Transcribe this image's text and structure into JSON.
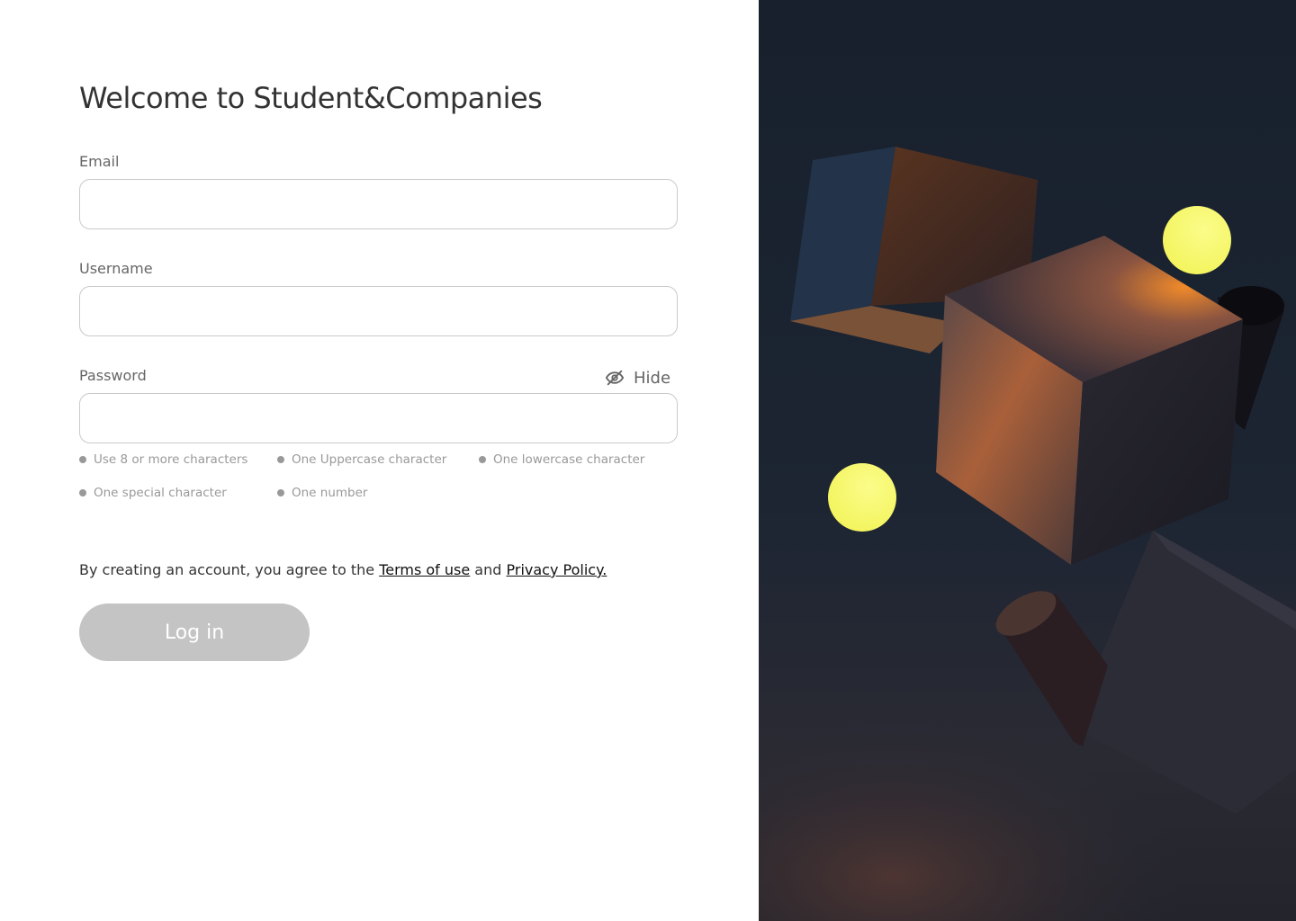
{
  "title": "Welcome to Student&Companies",
  "form": {
    "email": {
      "label": "Email",
      "value": "",
      "placeholder": ""
    },
    "username": {
      "label": "Username",
      "value": "",
      "placeholder": ""
    },
    "password": {
      "label": "Password",
      "value": "",
      "placeholder": "",
      "toggle_label": "Hide",
      "requirements": [
        "Use 8 or more characters",
        "One Uppercase character",
        "One lowercase character",
        "One special character",
        "One number"
      ]
    }
  },
  "agreement": {
    "prefix": "By creating an account, you agree to the ",
    "terms_link": "Terms of use",
    "and": " and ",
    "privacy_link": "Privacy Policy."
  },
  "login_button": {
    "label": "Log in",
    "enabled": false
  },
  "colors": {
    "button_disabled": "#c4c4c4",
    "text_primary": "#333333",
    "text_secondary": "#666666",
    "hint": "#999999",
    "hero_background": "#1a2230",
    "hero_accent_yellow": "#f7f86a",
    "hero_accent_orange": "#d97a3a"
  },
  "icons": {
    "password_toggle": "eye-slash-icon"
  }
}
